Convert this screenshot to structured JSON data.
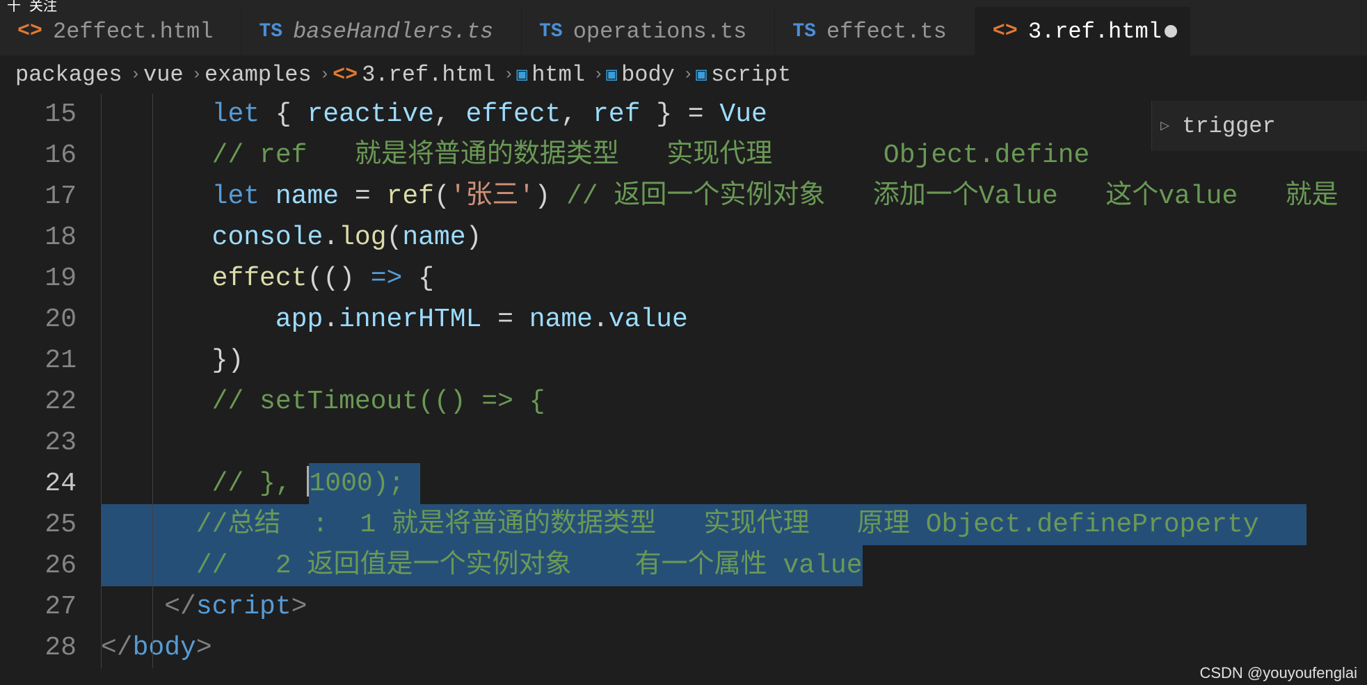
{
  "top": {
    "follow": "十 关注"
  },
  "tabs": [
    {
      "icon": "<>",
      "label": "2effect.html",
      "active": false,
      "italic": false,
      "iconClass": "html-icon"
    },
    {
      "icon": "TS",
      "label": "baseHandlers.ts",
      "active": false,
      "italic": true,
      "iconClass": "ts-icon"
    },
    {
      "icon": "TS",
      "label": "operations.ts",
      "active": false,
      "italic": false,
      "iconClass": "ts-icon"
    },
    {
      "icon": "TS",
      "label": "effect.ts",
      "active": false,
      "italic": false,
      "iconClass": "ts-icon"
    },
    {
      "icon": "<>",
      "label": "3.ref.html",
      "active": true,
      "italic": false,
      "iconClass": "html-icon",
      "modified": true
    }
  ],
  "breadcrumbs": [
    "packages",
    "vue",
    "examples",
    "3.ref.html",
    "html",
    "body",
    "script"
  ],
  "breadcrumbIcons": {
    "3.ref.html": "<>",
    "html": "cube",
    "body": "cube",
    "script": "cube"
  },
  "outline": {
    "label": "trigger"
  },
  "lines": {
    "start": 15,
    "l15": {
      "kw": "let",
      "p1": " { ",
      "v1": "reactive",
      "c1": ", ",
      "v2": "effect",
      "c2": ", ",
      "v3": "ref",
      "p2": " } = ",
      "v4": "Vue"
    },
    "l16": "// ref   就是将普通的数据类型   实现代理       Object.define",
    "l17": {
      "kw": "let",
      "s": " ",
      "v": "name",
      "eq": " = ",
      "fn": "ref",
      "po": "(",
      "str": "'张三'",
      "pc": ")",
      "com": " // 返回一个实例对象   添加一个Value   这个value   就是"
    },
    "l18": {
      "v1": "console",
      "d": ".",
      "fn": "log",
      "po": "(",
      "v2": "name",
      "pc": ")"
    },
    "l19": {
      "fn": "effect",
      "po": "((",
      "pc": ") ",
      "ar": "=>",
      "br": " {"
    },
    "l20": {
      "v1": "app",
      "d1": ".",
      "v2": "innerHTML",
      "eq": " = ",
      "v3": "name",
      "d2": ".",
      "v4": "value"
    },
    "l21": "})",
    "l22": "// setTimeout(() => {",
    "l23": "",
    "l24": {
      "pre": "// }, ",
      "selNum": "1000",
      "selRest": ");"
    },
    "l25": "//总结  :  1 就是将普通的数据类型   实现代理   原理 Object.defineProperty",
    "l26": "//   2 返回值是一个实例对象    有一个属性 value",
    "l27": {
      "o": "</",
      "t": "script",
      "c": ">"
    },
    "l28": {
      "o": "</",
      "t": "body",
      "c": ">"
    }
  },
  "watermark": "CSDN @youyoufenglai"
}
